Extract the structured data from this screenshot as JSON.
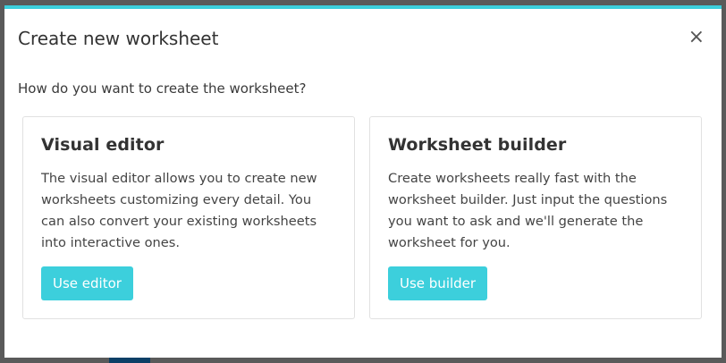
{
  "modal": {
    "title": "Create new worksheet",
    "close_label": "×",
    "question": "How do you want to create the worksheet?",
    "accent_color": "#3ccfdc"
  },
  "cards": [
    {
      "title": "Visual editor",
      "description": "The visual editor allows you to create new worksheets customizing every detail. You can also convert your existing worksheets into interactive ones.",
      "button_label": "Use editor"
    },
    {
      "title": "Worksheet builder",
      "description": "Create worksheets really fast with the worksheet builder. Just input the questions you want to ask and we'll generate the worksheet for you.",
      "button_label": "Use builder"
    }
  ]
}
